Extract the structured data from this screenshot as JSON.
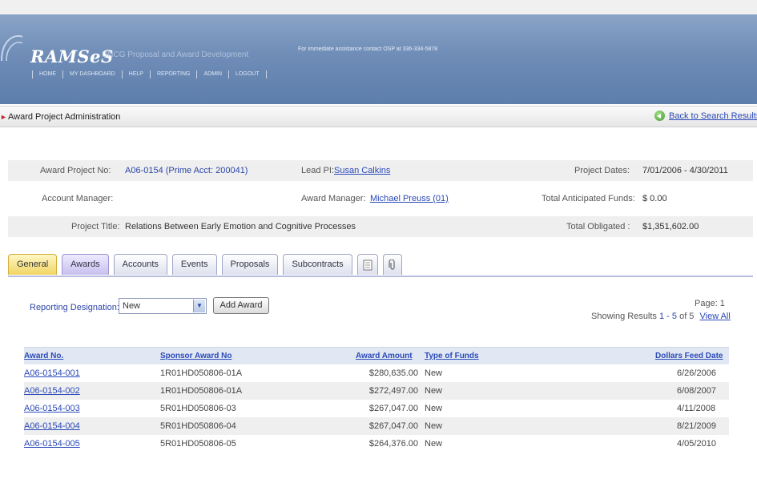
{
  "header": {
    "logo": "RAMSeS",
    "subtitle": "UNCG Proposal and Award Development",
    "assistance": "For immediate assistance contact OSP at 336-334-5878",
    "nav": [
      "HOME",
      "MY DASHBOARD",
      "HELP",
      "REPORTING",
      "ADMIN",
      "LOGOUT"
    ]
  },
  "section": {
    "title": "Award Project Administration",
    "back_link": "Back to Search Results/Lis"
  },
  "project": {
    "award_project_no_label": "Award Project No:",
    "award_project_no": "A06-0154 (Prime Acct: 200041)",
    "lead_pi_label": "Lead PI:",
    "lead_pi": "Susan Calkins",
    "project_dates_label": "Project Dates:",
    "project_dates": "7/01/2006 - 4/30/2011",
    "account_manager_label": "Account Manager:",
    "account_manager": "",
    "award_manager_label": "Award Manager:",
    "award_manager": "Michael Preuss (01)",
    "total_anticipated_label": "Total Anticipated Funds:",
    "total_anticipated": "$ 0.00",
    "project_title_label": "Project Title:",
    "project_title": "Relations Between Early Emotion and Cognitive Processes",
    "total_obligated_label": "Total Obligated :",
    "total_obligated": "$1,351,602.00"
  },
  "tabs": [
    "General",
    "Awards",
    "Accounts",
    "Events",
    "Proposals",
    "Subcontracts"
  ],
  "tab_icons": [
    "document-icon",
    "paperclip-icon"
  ],
  "controls": {
    "reporting_label": "Reporting Designation:",
    "reporting_value": "New",
    "add_award": "Add Award",
    "page_label": "Page: 1",
    "showing_prefix": "Showing Results",
    "showing_range": "1 - 5",
    "showing_of": "of 5",
    "view_all": "View All"
  },
  "table": {
    "headers": {
      "award_no": "Award No.",
      "sponsor_award_no": "Sponsor Award No",
      "award_amount": "Award Amount",
      "type_of_funds": "Type of Funds",
      "dollars_feed_date": "Dollars Feed Date"
    },
    "rows": [
      {
        "award_no": "A06-0154-001",
        "sponsor": "1R01HD050806-01A",
        "amount": "$280,635.00",
        "type": "New",
        "date": "6/26/2006"
      },
      {
        "award_no": "A06-0154-002",
        "sponsor": "1R01HD050806-01A",
        "amount": "$272,497.00",
        "type": "New",
        "date": "6/08/2007"
      },
      {
        "award_no": "A06-0154-003",
        "sponsor": "5R01HD050806-03",
        "amount": "$267,047.00",
        "type": "New",
        "date": "4/11/2008"
      },
      {
        "award_no": "A06-0154-004",
        "sponsor": "5R01HD050806-04",
        "amount": "$267,047.00",
        "type": "New",
        "date": "8/21/2009"
      },
      {
        "award_no": "A06-0154-005",
        "sponsor": "5R01HD050806-05",
        "amount": "$264,376.00",
        "type": "New",
        "date": "4/05/2010"
      }
    ]
  },
  "colors": {
    "banner": "#6f8db7",
    "link": "#2a49b8",
    "active_tab": "#f0d563"
  }
}
